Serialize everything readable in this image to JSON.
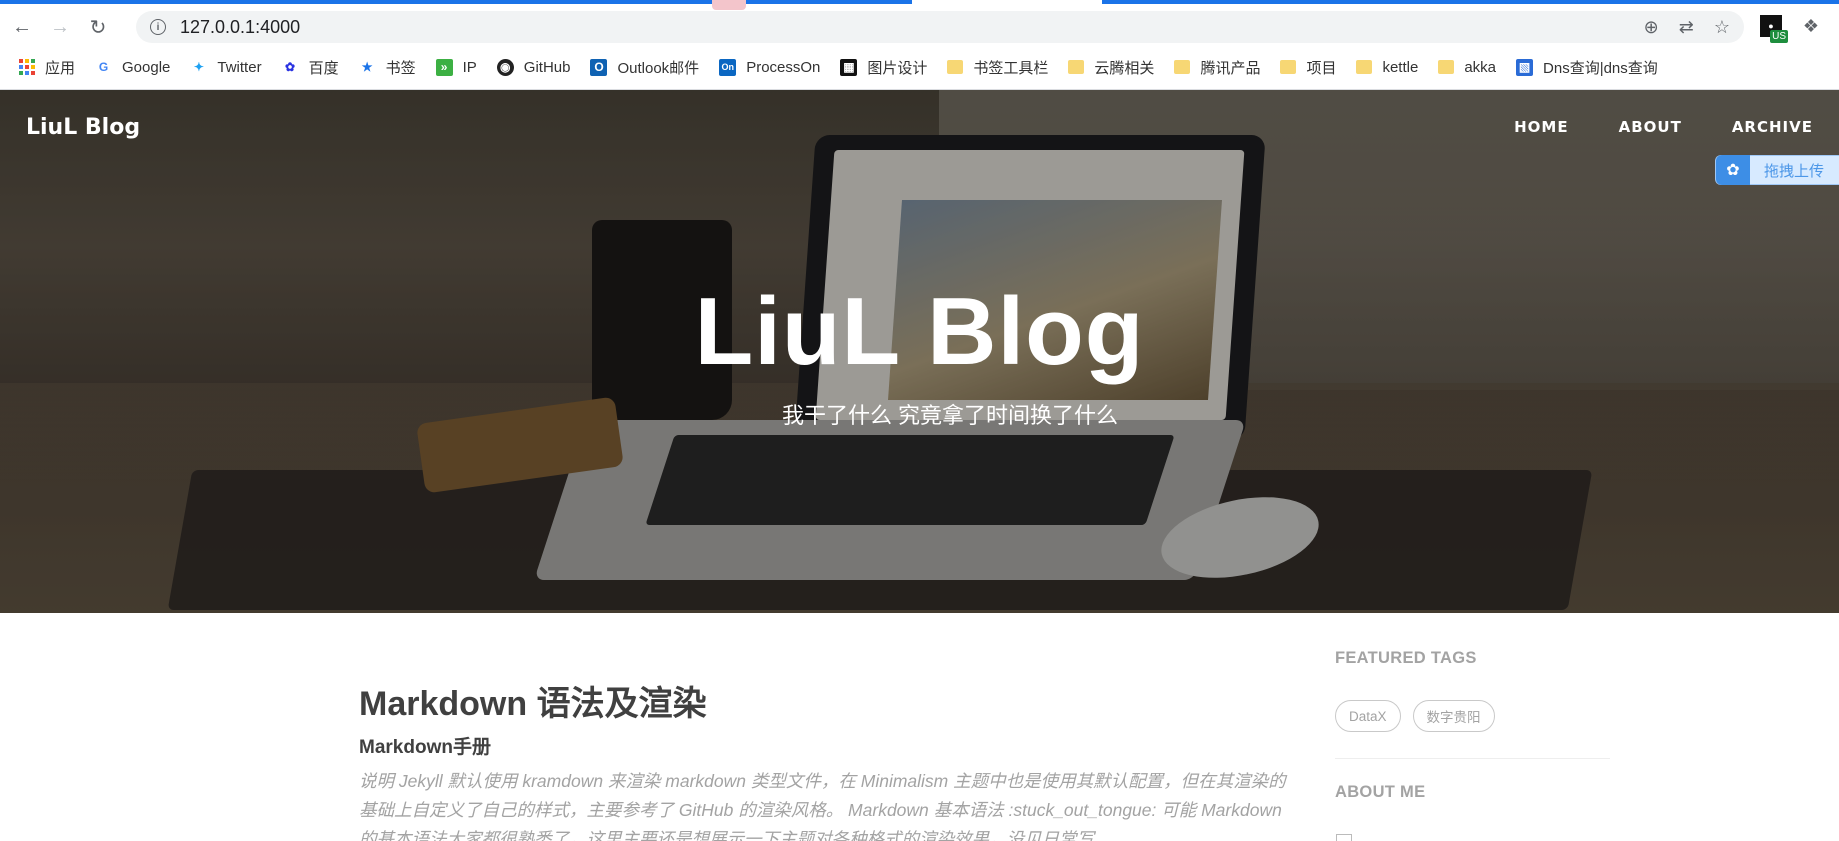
{
  "browser": {
    "url": "127.0.0.1:4000",
    "ext_badge": "US",
    "bookmarks": [
      {
        "label": "应用",
        "icon": "apps-icon"
      },
      {
        "label": "Google",
        "icon": "google-icon"
      },
      {
        "label": "Twitter",
        "icon": "twitter-icon"
      },
      {
        "label": "百度",
        "icon": "baidu-icon"
      },
      {
        "label": "书签",
        "icon": "star-icon"
      },
      {
        "label": "IP",
        "icon": "ip-icon"
      },
      {
        "label": "GitHub",
        "icon": "github-icon"
      },
      {
        "label": "Outlook邮件",
        "icon": "outlook-icon"
      },
      {
        "label": "ProcessOn",
        "icon": "processon-icon"
      },
      {
        "label": "图片设计",
        "icon": "design-icon"
      },
      {
        "label": "书签工具栏",
        "icon": "folder-icon"
      },
      {
        "label": "云腾相关",
        "icon": "folder-icon"
      },
      {
        "label": "腾讯产品",
        "icon": "folder-icon"
      },
      {
        "label": "项目",
        "icon": "folder-icon"
      },
      {
        "label": "kettle",
        "icon": "folder-icon"
      },
      {
        "label": "akka",
        "icon": "folder-icon"
      },
      {
        "label": "Dns查询|dns查询",
        "icon": "dns-icon"
      }
    ]
  },
  "site": {
    "brand": "LiuL Blog",
    "nav": [
      "HOME",
      "ABOUT",
      "ARCHIVE"
    ],
    "upload_widget": "拖拽上传",
    "hero_title": "LiuL Blog",
    "hero_subtitle": "我干了什么 究竟拿了时间换了什么"
  },
  "post": {
    "title": "Markdown 语法及渲染",
    "subtitle": "Markdown手册",
    "excerpt": "说明 Jekyll 默认使用 kramdown 来渲染 markdown 类型文件，在 Minimalism 主题中也是使用其默认配置，但在其渲染的基础上自定义了自己的样式，主要参考了 GitHub 的渲染风格。 Markdown 基本语法 :stuck_out_tongue: 可能 Markdown 的基本语法大家都很熟悉了，这里主要还是想展示一下主题对各种格式的渲染效果，没见日常写..."
  },
  "sidebar": {
    "featured_tags_heading": "FEATURED TAGS",
    "tags": [
      "DataX",
      "数字贵阳"
    ],
    "about_heading": "ABOUT ME"
  },
  "colors": {
    "accent": "#1a73e8",
    "text_dark": "#404040",
    "text_muted": "#a3a3a3"
  }
}
